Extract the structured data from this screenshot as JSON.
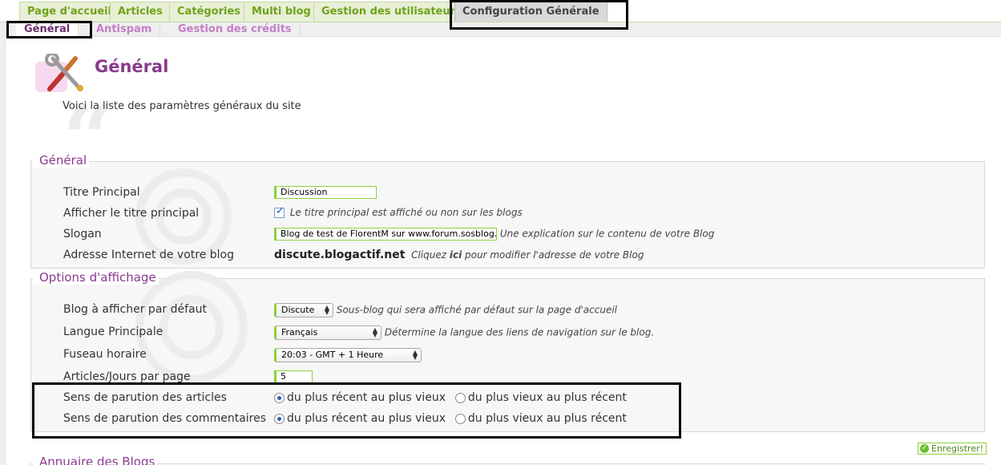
{
  "top_tabs": [
    "Page d'accueil",
    "Articles",
    "Catégories",
    "Multi blog",
    "Gestion des utilisateurs",
    "Configuration Générale"
  ],
  "sub_tabs": [
    "Général",
    "Antispam",
    "Gestion des crédits"
  ],
  "header": {
    "title": "Général",
    "description": "Voici la liste des paramètres généraux du site"
  },
  "section_general": {
    "legend": "Général",
    "rows": {
      "title_label": "Titre Principal",
      "title_value": "Discussion",
      "show_title_label": "Afficher le titre principal",
      "show_title_checked": true,
      "show_title_hint": "Le titre principal est affiché ou non sur les blogs",
      "slogan_label": "Slogan",
      "slogan_value": "Blog de test de FlorentM sur www.forum.sosblog.f",
      "slogan_hint": "Une explication sur le contenu de votre Blog",
      "url_label": "Adresse Internet de votre blog",
      "url_value": "discute.blogactif.net",
      "url_hint_before": "Cliquez",
      "url_hint_link": "ici",
      "url_hint_after": "pour modifier l'adresse de votre Blog"
    }
  },
  "section_display": {
    "legend": "Options d'affichage",
    "default_blog_label": "Blog à afficher par défaut",
    "default_blog_value": "Discute",
    "default_blog_hint": "Sous-blog qui sera affiché par défaut sur la page d'accueil",
    "language_label": "Langue Principale",
    "language_value": "Français",
    "language_hint": "Détermine la langue des liens de navigation sur le blog.",
    "timezone_label": "Fuseau horaire",
    "timezone_value": "20:03 - GMT + 1 Heure",
    "per_page_label": "Articles/Jours par page",
    "per_page_value": "5",
    "articles_order_label": "Sens de parution des articles",
    "comments_order_label": "Sens de parution des commentaires",
    "order_option_recent": "du plus récent au plus vieux",
    "order_option_old": "du plus vieux au plus récent",
    "articles_order_selected": "du plus récent au plus vieux",
    "comments_order_selected": "du plus récent au plus vieux"
  },
  "section_directory": {
    "legend": "Annuaire des Blogs"
  },
  "save_label": "Enregistrer!",
  "colors": {
    "tab_green": "#6fa31a",
    "accent_purple": "#8a3a8e",
    "active_subtab": "#6a2b6d",
    "input_border": "#8ccf3e"
  }
}
